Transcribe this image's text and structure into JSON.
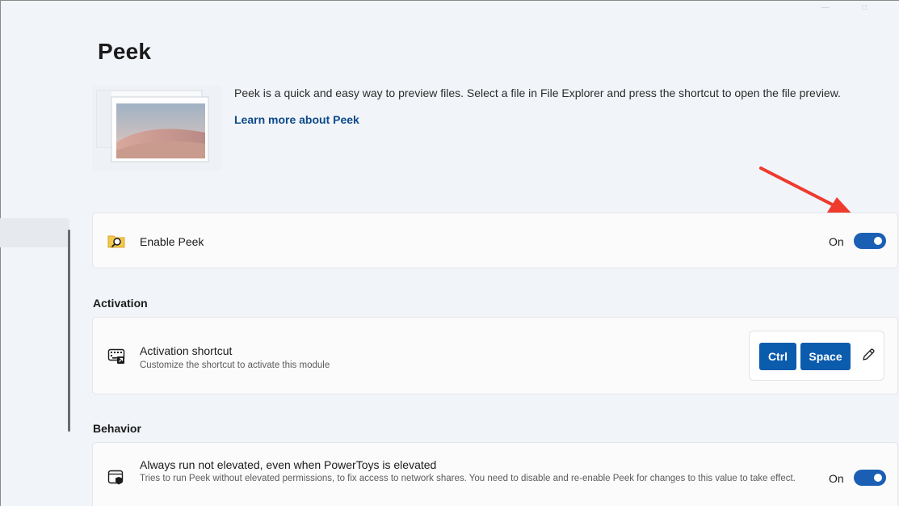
{
  "page": {
    "title": "Peek",
    "description": "Peek is a quick and easy way to preview files. Select a file in File Explorer and press the shortcut to open the file preview.",
    "learn_more": "Learn more about Peek"
  },
  "enable_card": {
    "label": "Enable Peek",
    "toggle_state": "On",
    "icon": "peek-folder-icon"
  },
  "activation": {
    "heading": "Activation",
    "shortcut_label": "Activation shortcut",
    "shortcut_desc": "Customize the shortcut to activate this module",
    "keys": [
      "Ctrl",
      "Space"
    ],
    "icon": "keyboard-icon",
    "edit_icon": "pencil-icon"
  },
  "behavior": {
    "heading": "Behavior",
    "elevated_label": "Always run not elevated, even when PowerToys is elevated",
    "elevated_desc": "Tries to run Peek without elevated permissions, to fix access to network shares. You need to disable and re-enable Peek for changes to this value to take effect.",
    "toggle_state": "On",
    "icon": "shield-window-icon"
  },
  "colors": {
    "accent": "#1a5fb4",
    "key_bg": "#0b5cad",
    "link": "#0d4a8a",
    "annotation_arrow": "#ee3b2e"
  }
}
